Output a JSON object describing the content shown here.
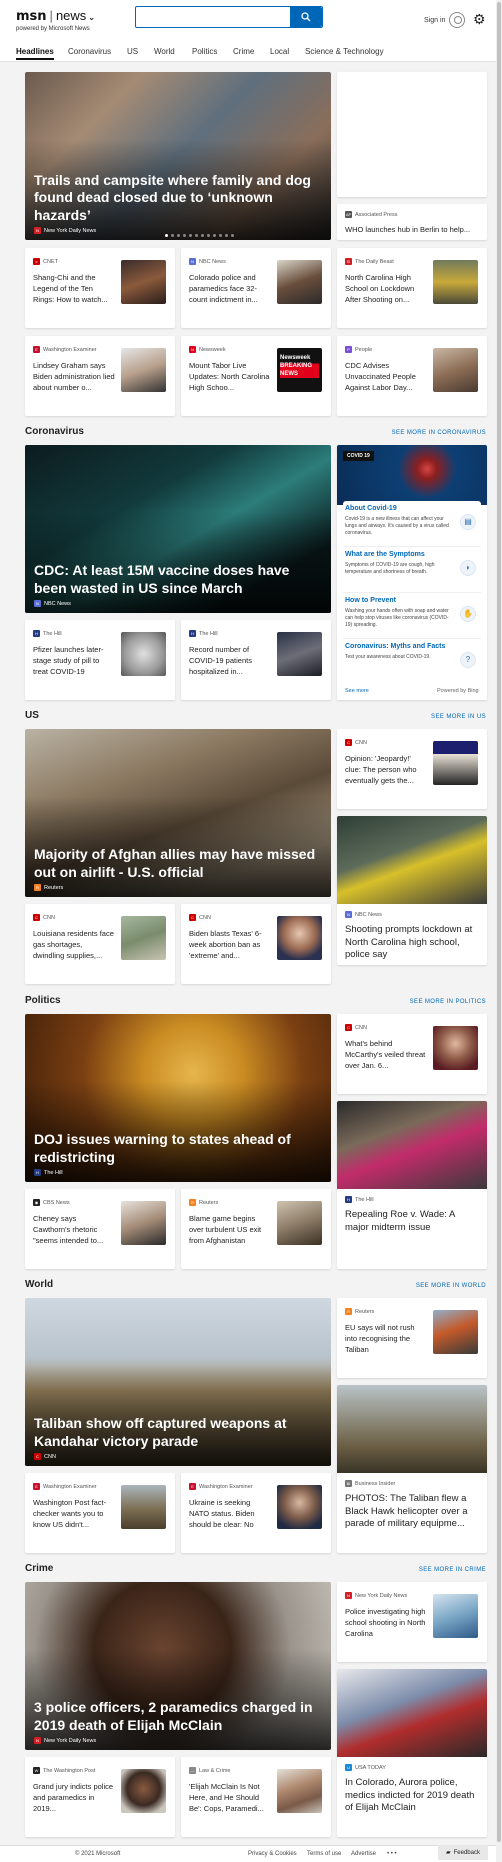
{
  "header": {
    "logo_msn": "msn",
    "logo_news": "news",
    "powered_by": "powered by Microsoft News",
    "search_placeholder": "",
    "search_value": "",
    "signin_label": "Sign in"
  },
  "nav": [
    "Headlines",
    "Coronavirus",
    "US",
    "World",
    "Politics",
    "Crime",
    "Local",
    "Science & Technology"
  ],
  "top": {
    "hero": {
      "title": "Trails and campsite where family and dog found dead closed due to ‘unknown hazards’",
      "source": "New York Daily News"
    },
    "side": {
      "source": "Associated Press",
      "title": "WHO launches hub in Berlin to help..."
    },
    "row1": [
      {
        "source": "CNET",
        "title": "Shang-Chi and the Legend of the Ten Rings: How to watch..."
      },
      {
        "source": "NBC News",
        "title": "Colorado police and paramedics face 32-count indictment in..."
      },
      {
        "source": "The Daily Beast",
        "title": "North Carolina High School on Lockdown After Shooting on..."
      }
    ],
    "row2": [
      {
        "source": "Washington Examiner",
        "title": "Lindsey Graham says Biden administration lied about number o..."
      },
      {
        "source": "Newsweek",
        "title": "Mount Tabor Live Updates: North Carolina High Schoo...",
        "thumb_text": "Newsweek BREAKING NEWS"
      },
      {
        "source": "People",
        "title": "CDC Advises Unvaccinated People Against Labor Day..."
      }
    ]
  },
  "sections": [
    {
      "title": "Coronavirus",
      "more": "SEE MORE IN CORONAVIRUS",
      "hero": {
        "title": "CDC: At least 15M vaccine doses have been wasted in US since March",
        "source": "NBC News"
      },
      "cards": [
        {
          "source": "The Hill",
          "title": "Pfizer launches later-stage study of pill to treat COVID-19"
        },
        {
          "source": "The Hill",
          "title": "Record number of COVID-19 patients hospitalized in..."
        }
      ]
    },
    {
      "title": "US",
      "more": "SEE MORE IN US",
      "hero": {
        "title": "Majority of Afghan allies may have missed out on airlift - U.S. official",
        "source": "Reuters"
      },
      "cards": [
        {
          "source": "CNN",
          "title": "Louisiana residents face gas shortages, dwindling supplies,..."
        },
        {
          "source": "CNN",
          "title": "Biden blasts Texas' 6-week abortion ban as 'extreme' and..."
        }
      ],
      "side_small": {
        "source": "CNN",
        "title": "Opinion: 'Jeopardy!' clue: The person who eventually gets the..."
      },
      "side_img": {
        "source": "NBC News",
        "title": "Shooting prompts lockdown at North Carolina high school, police say"
      }
    },
    {
      "title": "Politics",
      "more": "SEE MORE IN POLITICS",
      "hero": {
        "title": "DOJ issues warning to states ahead of redistricting",
        "source": "The Hill"
      },
      "cards": [
        {
          "source": "CBS News",
          "title": "Cheney says Cawthorn's rhetoric \"seems intended to..."
        },
        {
          "source": "Reuters",
          "title": "Blame game begins over turbulent US exit from Afghanistan"
        }
      ],
      "side_small": {
        "source": "CNN",
        "title": "What's behind McCarthy's veiled threat over Jan. 6..."
      },
      "side_img": {
        "source": "The Hill",
        "title": "Repealing Roe v. Wade: A major midterm issue"
      }
    },
    {
      "title": "World",
      "more": "SEE MORE IN WORLD",
      "hero": {
        "title": "Taliban show off captured weapons at Kandahar victory parade",
        "source": "CNN"
      },
      "cards": [
        {
          "source": "Washington Examiner",
          "title": "Washington Post fact-checker wants you to know US didn't..."
        },
        {
          "source": "Washington Examiner",
          "title": "Ukraine is seeking NATO status. Biden should be clear: No"
        }
      ],
      "side_small": {
        "source": "Reuters",
        "title": "EU says will not rush into recognising the Taliban"
      },
      "side_img": {
        "source": "Business Insider",
        "title": "PHOTOS: The Taliban flew a Black Hawk helicopter over a parade of military equipme..."
      }
    },
    {
      "title": "Crime",
      "more": "SEE MORE IN CRIME",
      "hero": {
        "title": "3 police officers, 2 paramedics charged in 2019 death of Elijah McClain",
        "source": "New York Daily News"
      },
      "cards": [
        {
          "source": "The Washington Post",
          "title": "Grand jury indicts police and paramedics in 2019..."
        },
        {
          "source": "Law & Crime",
          "title": "'Elijah McClain Is Not Here, and He Should Be': Cops, Paramedi..."
        }
      ],
      "side_small": {
        "source": "New York Daily News",
        "title": "Police investigating high school shooting in North Carolina"
      },
      "side_img": {
        "source": "USA TODAY",
        "title": "In Colorado, Aurora police, medics indicted for 2019 death of Elijah McClain"
      }
    }
  ],
  "covid_panel": {
    "badge": "COVID 19",
    "items": [
      {
        "title": "About Covid-19",
        "desc": "Covid-19 is a new illness that can affect your lungs and airways. It's caused by a virus called coronavirus."
      },
      {
        "title": "What are the Symptoms",
        "desc": "Symptoms of COVID-19 are cough, high temperature and shortness of breath."
      },
      {
        "title": "How to Prevent",
        "desc": "Washing your hands often with soap and water can help stop viruses like coronavirus (COVID-19) spreading."
      },
      {
        "title": "Coronavirus: Myths and Facts",
        "desc": "Test your awareness about COVID-19."
      }
    ],
    "see_more": "See more",
    "powered": "Powered by Bing"
  },
  "footer": {
    "copyright": "© 2021 Microsoft",
    "links": [
      "Privacy & Cookies",
      "Terms of use",
      "Advertise"
    ],
    "more": "• • •",
    "feedback": "Feedback"
  }
}
